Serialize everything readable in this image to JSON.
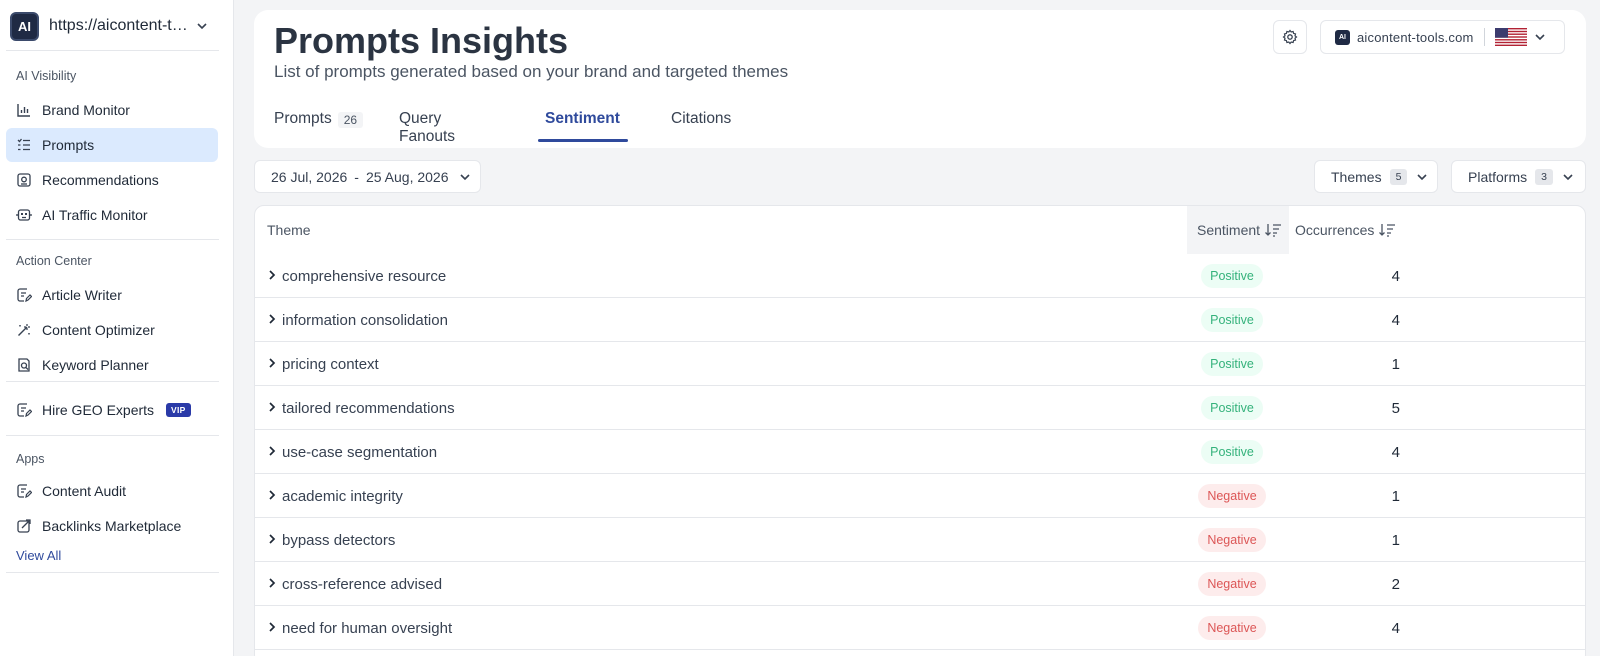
{
  "site": {
    "url": "https://aicontent-tools.com",
    "logo_text": "AI"
  },
  "sidebar": {
    "section_visibility": "AI Visibility",
    "item_brand_monitor": "Brand Monitor",
    "item_prompts": "Prompts",
    "item_recommendations": "Recommendations",
    "item_ai_traffic_monitor": "AI Traffic Monitor",
    "section_action": "Action Center",
    "item_article_writer": "Article Writer",
    "item_content_optimizer": "Content Optimizer",
    "item_keyword_planner": "Keyword Planner",
    "item_hire_geo": "Hire GEO Experts",
    "vip_badge": "VIP",
    "section_apps": "Apps",
    "item_content_audit": "Content Audit",
    "item_backlinks": "Backlinks Marketplace",
    "view_all": "View All"
  },
  "header": {
    "title": "Prompts Insights",
    "subtitle": "List of prompts generated based on your brand and targeted themes",
    "domain": "aicontent-tools.com",
    "domain_logo": "AI"
  },
  "tabs": {
    "prompts": "Prompts",
    "prompts_count": "26",
    "query_fanouts": "Query Fanouts",
    "sentiment": "Sentiment",
    "citations": "Citations"
  },
  "filters": {
    "date_from": "26 Jul, 2026",
    "date_sep": "-",
    "date_to": "25 Aug, 2026",
    "themes_label": "Themes",
    "themes_count": "5",
    "platforms_label": "Platforms",
    "platforms_count": "3"
  },
  "table": {
    "col_theme": "Theme",
    "col_sentiment": "Sentiment",
    "col_occurrences": "Occurrences",
    "rows": [
      {
        "theme": "comprehensive resource",
        "sentiment": "Positive",
        "occurrences": "4"
      },
      {
        "theme": "information consolidation",
        "sentiment": "Positive",
        "occurrences": "4"
      },
      {
        "theme": "pricing context",
        "sentiment": "Positive",
        "occurrences": "1"
      },
      {
        "theme": "tailored recommendations",
        "sentiment": "Positive",
        "occurrences": "5"
      },
      {
        "theme": "use-case segmentation",
        "sentiment": "Positive",
        "occurrences": "4"
      },
      {
        "theme": "academic integrity",
        "sentiment": "Negative",
        "occurrences": "1"
      },
      {
        "theme": "bypass detectors",
        "sentiment": "Negative",
        "occurrences": "1"
      },
      {
        "theme": "cross-reference advised",
        "sentiment": "Negative",
        "occurrences": "2"
      },
      {
        "theme": "need for human oversight",
        "sentiment": "Negative",
        "occurrences": "4"
      }
    ]
  },
  "colors": {
    "accent": "#2f4a9c",
    "positive": "#34b27b",
    "negative": "#dc5656",
    "active_nav_bg": "#dbeafe"
  }
}
